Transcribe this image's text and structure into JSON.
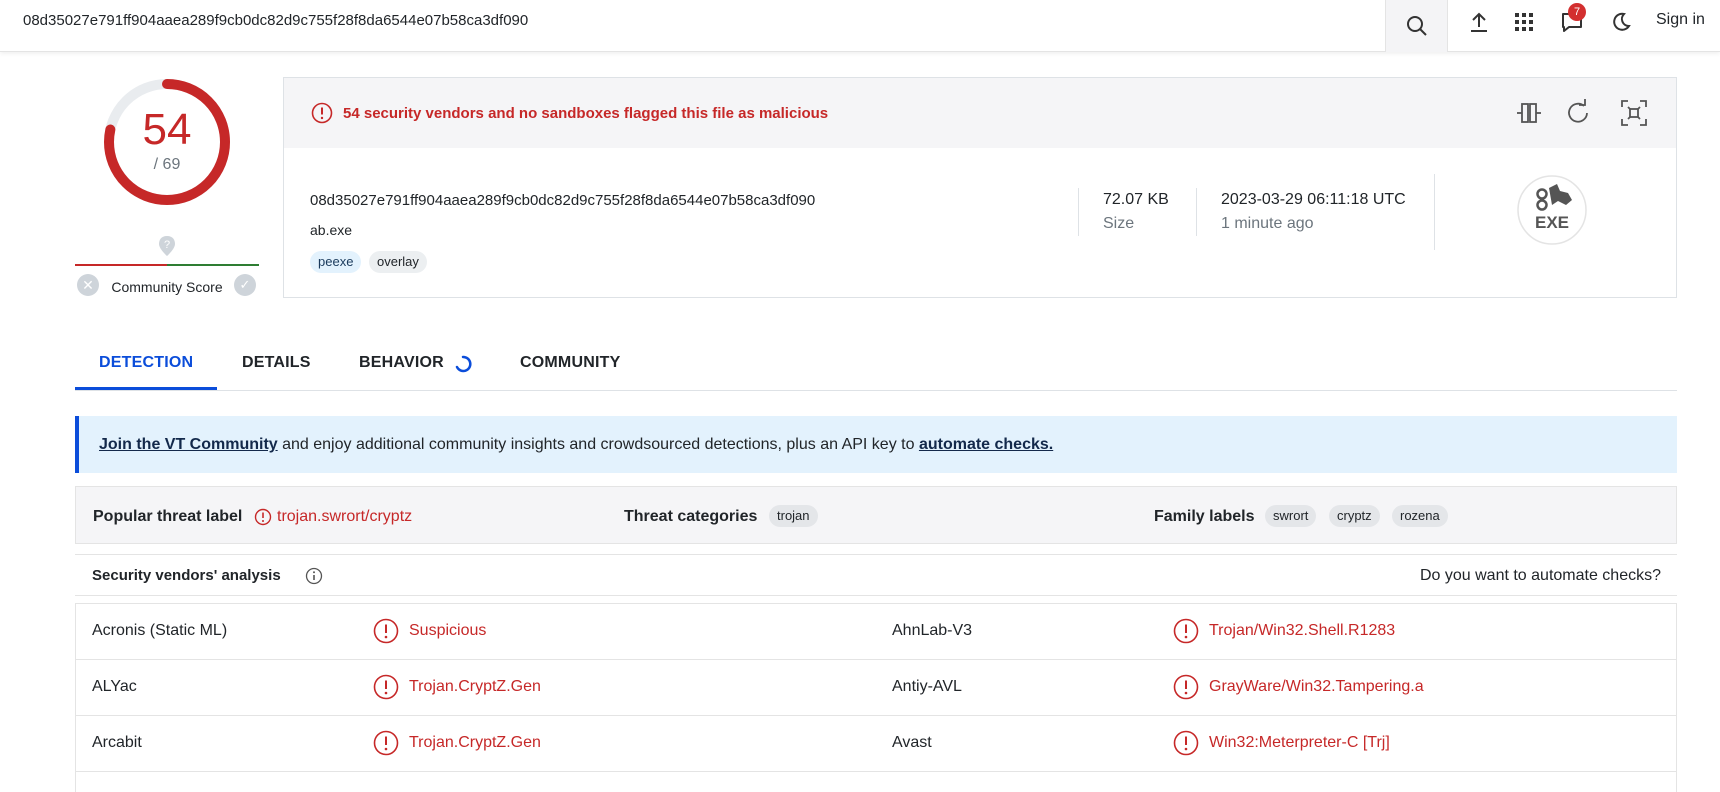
{
  "search": {
    "query": "08d35027e791ff904aaea289f9cb0dc82d9c755f28f8da6544e07b58ca3df090"
  },
  "topbar": {
    "notification_count": "7",
    "signin_label": "Sign in"
  },
  "score": {
    "detections": "54",
    "total": "/ 69",
    "community_label": "Community Score"
  },
  "summary": {
    "alert_text": "54 security vendors and no sandboxes flagged this file as malicious",
    "hash": "08d35027e791ff904aaea289f9cb0dc82d9c755f28f8da6544e07b58ca3df090",
    "filename": "ab.exe",
    "tags": [
      "peexe",
      "overlay"
    ],
    "size_value": "72.07 KB",
    "size_label": "Size",
    "date_value": "2023-03-29 06:11:18 UTC",
    "date_label": "1 minute ago",
    "filetype_label": "EXE"
  },
  "tabs": [
    "DETECTION",
    "DETAILS",
    "BEHAVIOR",
    "COMMUNITY"
  ],
  "banner": {
    "link1": "Join the VT Community",
    "middle": " and enjoy additional community insights and crowdsourced detections, plus an API key to ",
    "link2": "automate checks."
  },
  "threat": {
    "popular_label": "Popular threat label",
    "popular_value": "trojan.swrort/cryptz",
    "categories_label": "Threat categories",
    "categories": [
      "trojan"
    ],
    "family_label": "Family labels",
    "families": [
      "swrort",
      "cryptz",
      "rozena"
    ]
  },
  "vendors": {
    "title": "Security vendors' analysis",
    "automate": "Do you want to automate checks?",
    "rows": [
      {
        "left_name": "Acronis (Static ML)",
        "left_result": "Suspicious",
        "right_name": "AhnLab-V3",
        "right_result": "Trojan/Win32.Shell.R1283"
      },
      {
        "left_name": "ALYac",
        "left_result": "Trojan.CryptZ.Gen",
        "right_name": "Antiy-AVL",
        "right_result": "GrayWare/Win32.Tampering.a"
      },
      {
        "left_name": "Arcabit",
        "left_result": "Trojan.CryptZ.Gen",
        "right_name": "Avast",
        "right_result": "Win32:Meterpreter-C [Trj]"
      }
    ]
  },
  "colors": {
    "malicious": "#c62828",
    "accent": "#0b4dda",
    "clean": "#2e7d32"
  },
  "icons": [
    "search-icon",
    "upload-icon",
    "apps-grid-icon",
    "chat-icon",
    "moon-icon",
    "alert-icon",
    "compare-icon",
    "reanalyze-icon",
    "graph-icon",
    "exe-file-icon",
    "info-icon"
  ]
}
